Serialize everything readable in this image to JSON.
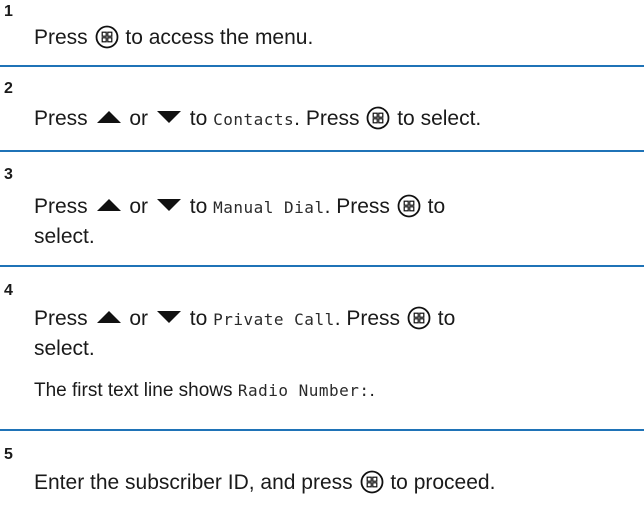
{
  "steps": [
    {
      "number": "1",
      "text_before": "Press",
      "text_after": "to access the menu."
    },
    {
      "number": "2",
      "press": "Press",
      "or": "or",
      "to": "to",
      "menu_item": "Contacts",
      "after_item": ". Press",
      "after_icon": "to select."
    },
    {
      "number": "3",
      "press": "Press",
      "or": "or",
      "to": "to",
      "menu_item": "Manual Dial",
      "after_item": ". Press",
      "after_icon": "to",
      "continuation": "select."
    },
    {
      "number": "4",
      "press": "Press",
      "or": "or",
      "to": "to",
      "menu_item": "Private Call",
      "after_item": ". Press",
      "after_icon": "to",
      "continuation": "select.",
      "note_before": "The first text line shows",
      "note_code": "Radio Number:",
      "note_after": "."
    },
    {
      "number": "5",
      "text_before": "Enter the subscriber ID, and press",
      "text_after": "to proceed."
    }
  ],
  "icons": {
    "menu_ok": "menu-ok-button-icon",
    "up": "up-arrow-icon",
    "down": "down-arrow-icon"
  },
  "colors": {
    "divider": "#1f73b7",
    "text": "#1a1a1a"
  }
}
